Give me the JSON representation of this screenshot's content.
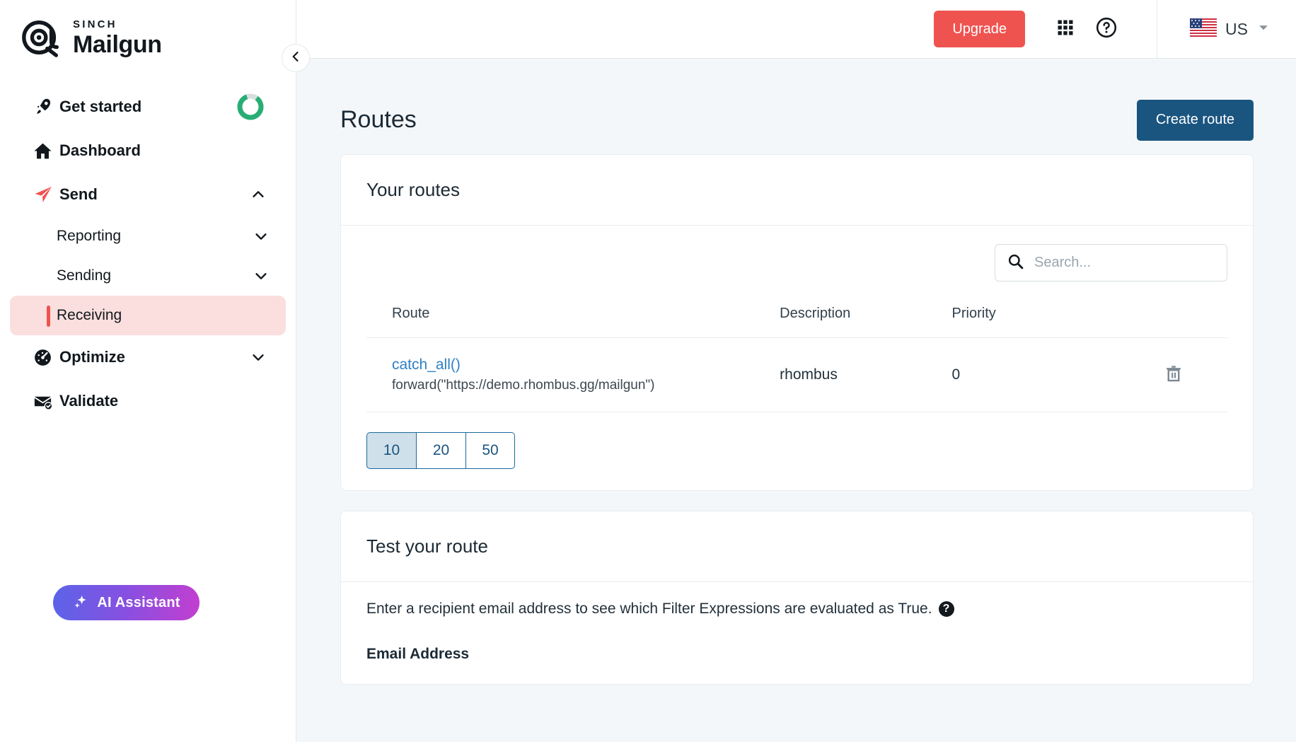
{
  "brand": {
    "sinch": "SINCH",
    "name": "Mailgun",
    "logo_icon": "mailgun-at-logo",
    "accent_red": "#ef5350",
    "accent_blue": "#1a5580",
    "accent_green": "#27ae74"
  },
  "sidebar": {
    "collapse_icon": "chevron-left-icon",
    "items": [
      {
        "label": "Get started",
        "icon": "rocket-icon",
        "type": "link",
        "progress": 85,
        "has_progress": true
      },
      {
        "label": "Dashboard",
        "icon": "home-icon",
        "type": "link"
      },
      {
        "label": "Send",
        "icon": "paper-plane-icon",
        "type": "group",
        "expanded": true,
        "chevron": "chevron-up-icon"
      }
    ],
    "send_children": [
      {
        "label": "Reporting",
        "chevron": "chevron-down-icon",
        "active": false
      },
      {
        "label": "Sending",
        "chevron": "chevron-down-icon",
        "active": false
      },
      {
        "label": "Receiving",
        "chevron": "",
        "active": true
      }
    ],
    "items_after": [
      {
        "label": "Optimize",
        "icon": "gauge-icon",
        "type": "group",
        "chevron": "chevron-down-icon"
      },
      {
        "label": "Validate",
        "icon": "envelope-check-icon",
        "type": "link"
      }
    ],
    "ai_assistant": {
      "label": "AI Assistant",
      "icon": "sparkles-icon"
    }
  },
  "topbar": {
    "upgrade_label": "Upgrade",
    "apps_icon": "grid-apps-icon",
    "help_icon": "help-circle-icon",
    "locale_label": "US",
    "flag_icon": "us-flag-icon",
    "locale_chevron": "chevron-down-icon"
  },
  "page": {
    "title": "Routes",
    "create_button": "Create route"
  },
  "routes_card": {
    "heading": "Your routes",
    "search": {
      "placeholder": "Search...",
      "value": "",
      "icon": "search-icon"
    },
    "columns": [
      "Route",
      "Description",
      "Priority",
      ""
    ],
    "rows": [
      {
        "route": "catch_all()",
        "route_action": "forward(\"https://demo.rhombus.gg/mailgun\")",
        "description": "rhombus",
        "priority": "0",
        "delete_icon": "trash-icon"
      }
    ],
    "page_sizes": [
      "10",
      "20",
      "50"
    ],
    "page_size_selected": "10"
  },
  "test_card": {
    "heading": "Test your route",
    "description": "Enter a recipient email address to see which Filter Expressions are evaluated as True.",
    "help_icon": "help-circle-filled-icon",
    "help_glyph": "?",
    "email_label": "Email Address"
  }
}
